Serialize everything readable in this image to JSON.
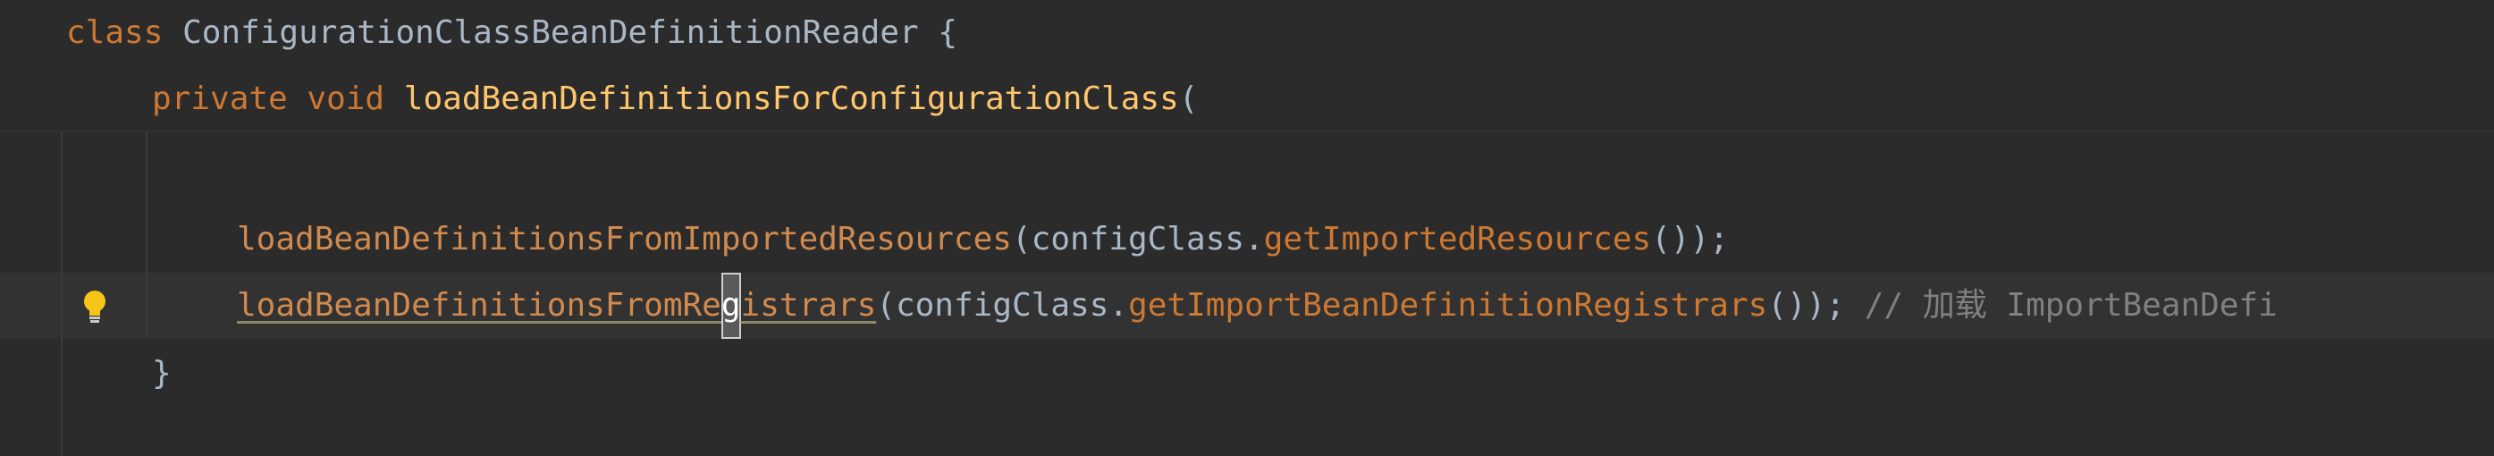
{
  "editor": {
    "line1": {
      "keyword": "class",
      "class_name": "ConfigurationClassBeanDefinitionReader",
      "brace": "{"
    },
    "line2": {
      "modifier": "private",
      "return_type": "void",
      "method_name": "loadBeanDefinitionsForConfigurationClass",
      "paren": "("
    },
    "line4": {
      "call": "loadBeanDefinitionsFromImportedResources",
      "open": "(",
      "arg_obj": "configClass",
      "dot": ".",
      "arg_call": "getImportedResources",
      "close": "());"
    },
    "line5": {
      "call_before_caret": "loadBeanDefinitionsFromRe",
      "caret_char": "g",
      "call_after_caret": "istrars",
      "open": "(",
      "arg_obj": "configClass",
      "dot": ".",
      "arg_call": "getImportBeanDefinitionRegistrars",
      "close": "());",
      "comment": "// 加载 ImportBeanDefi"
    },
    "line6": {
      "brace": "}"
    }
  },
  "icons": {
    "intention": "lightbulb-icon"
  },
  "colors": {
    "background": "#2b2b2b",
    "keyword": "#cc7832",
    "method_decl": "#ffc66d",
    "text": "#a9b7c6",
    "comment": "#808080",
    "bulb": "#f5c518"
  }
}
